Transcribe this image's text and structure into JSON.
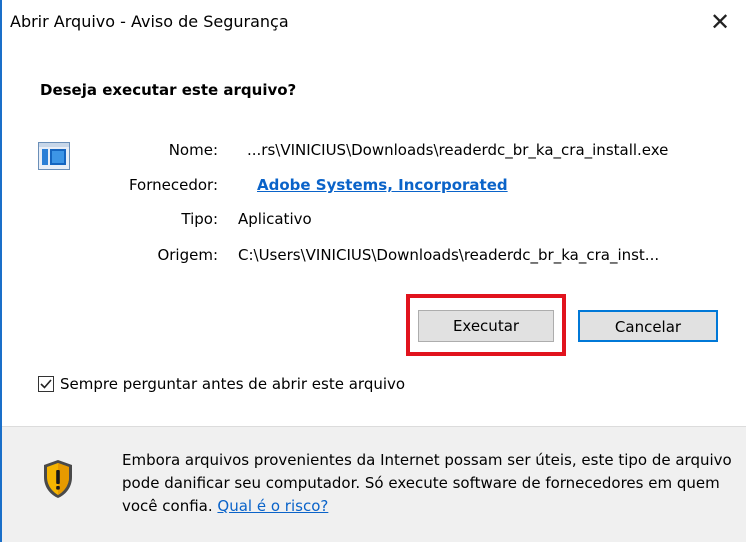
{
  "window": {
    "title": "Abrir Arquivo - Aviso de Segurança",
    "close_symbol": "✕"
  },
  "dialog": {
    "question": "Deseja executar este arquivo?",
    "file_icon": "application-window-icon",
    "fields": {
      "name_label": "Nome:",
      "name_value": "...rs\\VINICIUS\\Downloads\\readerdc_br_ka_cra_install.exe",
      "publisher_label": "Fornecedor:",
      "publisher_value": "Adobe Systems, Incorporated",
      "type_label": "Tipo:",
      "type_value": "Aplicativo",
      "origin_label": "Origem:",
      "origin_value": "C:\\Users\\VINICIUS\\Downloads\\readerdc_br_ka_cra_inst..."
    },
    "buttons": {
      "execute": "Executar",
      "cancel": "Cancelar"
    },
    "checkbox": {
      "label": "Sempre perguntar antes de abrir este arquivo",
      "checked": true
    }
  },
  "footer": {
    "icon": "warning-shield-icon",
    "warning_text": "Embora arquivos provenientes da Internet possam ser úteis, este tipo de arquivo pode danificar seu computador. Só execute software de fornecedores em quem você confia.",
    "risk_link": "Qual é o risco?"
  },
  "colors": {
    "accent": "#0078d7",
    "link": "#0a63c9",
    "highlight": "#e1131d",
    "footer_bg": "#f0f0f0"
  }
}
